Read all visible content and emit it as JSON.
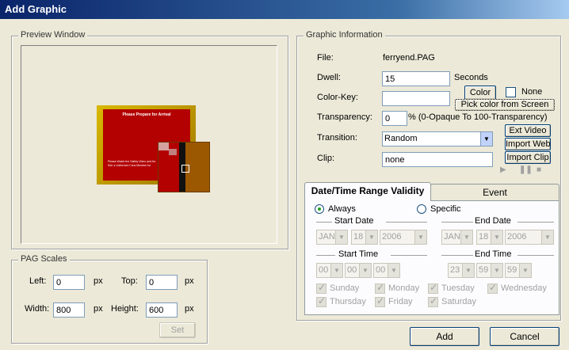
{
  "window": {
    "title": "Add Graphic"
  },
  "preview": {
    "group_title": "Preview Window",
    "slide_title": "Please Prepare for Arrival",
    "slide_body": "Please Watch the Safety Video and Arr See a Uniformed Crew Member for",
    "colors": {
      "frame": "#c8a000",
      "slide": "#b30000",
      "overlay": "#9c5800"
    }
  },
  "pag_scales": {
    "group_title": "PAG Scales",
    "left_label": "Left:",
    "left_value": "0",
    "left_unit": "px",
    "top_label": "Top:",
    "top_value": "0",
    "top_unit": "px",
    "width_label": "Width:",
    "width_value": "800",
    "width_unit": "px",
    "height_label": "Height:",
    "height_value": "600",
    "height_unit": "px",
    "set_label": "Set"
  },
  "info": {
    "group_title": "Graphic Information",
    "file_label": "File:",
    "file_value": "ferryend.PAG",
    "dwell_label": "Dwell:",
    "dwell_value": "15",
    "dwell_unit": "Seconds",
    "colorkey_label": "Color-Key:",
    "colorkey_value": "",
    "color_button": "Color",
    "none_label": "None",
    "pick_button": "Pick color from Screen",
    "transparency_label": "Transparency:",
    "transparency_value": "0",
    "transparency_hint": "% (0-Opaque To 100-Transparency)",
    "transition_label": "Transition:",
    "transition_value": "Random",
    "clip_label": "Clip:",
    "clip_value": "none",
    "ext_video_button": "Ext Video",
    "import_web_button": "Import Web",
    "import_clip_button": "Import Clip"
  },
  "tabs": {
    "validity": "Date/Time Range Validity",
    "event": "Event"
  },
  "validity": {
    "always_label": "Always",
    "specific_label": "Specific",
    "start_date_label": "Start Date",
    "end_date_label": "End Date",
    "start_date": {
      "month": "JAN",
      "day": "18",
      "year": "2006"
    },
    "end_date": {
      "month": "JAN",
      "day": "18",
      "year": "2006"
    },
    "start_time_label": "Start Time",
    "end_time_label": "End Time",
    "start_time": {
      "h": "00",
      "m": "00",
      "s": "00"
    },
    "end_time": {
      "h": "23",
      "m": "59",
      "s": "59"
    },
    "days": {
      "sun": "Sunday",
      "mon": "Monday",
      "tue": "Tuesday",
      "wed": "Wednesday",
      "thu": "Thursday",
      "fri": "Friday",
      "sat": "Saturday"
    }
  },
  "footer": {
    "add_button": "Add",
    "cancel_button": "Cancel"
  }
}
